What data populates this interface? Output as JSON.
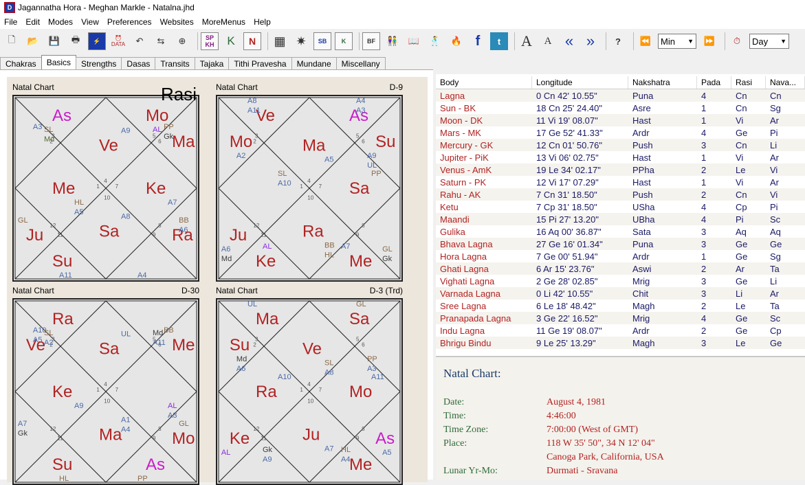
{
  "window": {
    "title": "Jagannatha Hora - Meghan Markle - Natalna.jhd",
    "icon": "jhora-app-icon"
  },
  "menu": [
    "File",
    "Edit",
    "Modes",
    "View",
    "Preferences",
    "Websites",
    "MoreMenus",
    "Help"
  ],
  "toolbar": {
    "icons": [
      "new-file-icon",
      "open-folder-icon",
      "save-icon",
      "print-icon",
      "data-icon",
      "clock-data-icon",
      "undo-arrow-icon",
      "redo-arrow-icon",
      "circle-chart-icon",
      "sp-kh-icon",
      "k-icon",
      "n-icon",
      "grid-chart-icon",
      "sun-rays-icon",
      "sb-icon",
      "k-square-icon",
      "bf-grid-icon",
      "couple-icon",
      "book-icon",
      "dancing-icon",
      "fire-icon",
      "facebook-icon",
      "twitter-icon",
      "font-large-icon",
      "font-small-icon",
      "back-icon",
      "forward-icon",
      "help-icon",
      "step-back-icon",
      "step-forward-icon",
      "transit-clock-icon"
    ],
    "labels": {
      "sp": "SP",
      "kh": "KH",
      "k": "K",
      "n": "N",
      "sb": "SB",
      "bf": "BF",
      "data": "DATA",
      "font_large": "A",
      "font_small": "A",
      "help": "?"
    },
    "time_unit": "Min",
    "date_unit": "Day"
  },
  "tabs": [
    "Chakras",
    "Basics",
    "Strengths",
    "Dasas",
    "Transits",
    "Tajaka",
    "Tithi Pravesha",
    "Mundane",
    "Miscellany"
  ],
  "active_tab": "Basics",
  "charts": [
    {
      "title": "Natal Chart",
      "division": "",
      "overlay": "Rasi",
      "house_numbers": [
        "4",
        "3",
        "2",
        "1",
        "12",
        "11",
        "10",
        "9",
        "8",
        "7",
        "6",
        "5"
      ],
      "planets": [
        {
          "t": "Ve",
          "c": "red"
        },
        {
          "t": "Su",
          "c": "red"
        },
        {
          "t": "Ma",
          "c": "red"
        },
        {
          "t": "Me",
          "c": "red"
        },
        {
          "t": "Ra",
          "c": "red"
        },
        {
          "t": "As",
          "c": "mag"
        },
        {
          "t": "Sa",
          "c": "red"
        },
        {
          "t": "Mo",
          "c": "red"
        },
        {
          "t": "Ju",
          "c": "red"
        },
        {
          "t": "Ke",
          "c": "red"
        }
      ],
      "labels": [
        {
          "t": "SL",
          "c": "brown"
        },
        {
          "t": "BB",
          "c": "brown"
        },
        {
          "t": "HL",
          "c": "brown"
        },
        {
          "t": "PP",
          "c": "brown"
        },
        {
          "t": "A11",
          "c": "blue"
        },
        {
          "t": "A9",
          "c": "blue"
        },
        {
          "t": "A4",
          "c": "blue"
        },
        {
          "t": "A3",
          "c": "blue"
        },
        {
          "t": "A7",
          "c": "blue"
        },
        {
          "t": "GL",
          "c": "brown"
        },
        {
          "t": "AL",
          "c": "purple"
        },
        {
          "t": "A8",
          "c": "blue"
        },
        {
          "t": "Md",
          "c": "green"
        },
        {
          "t": "A6",
          "c": "blue"
        },
        {
          "t": "A5",
          "c": "blue"
        },
        {
          "t": "Gk",
          "c": "dark"
        },
        {
          "t": "A9",
          "c": "blue"
        }
      ]
    },
    {
      "title": "Natal Chart",
      "division": "D-9",
      "overlay": "",
      "house_numbers": [
        "4",
        "3",
        "2",
        "1",
        "12",
        "11",
        "10",
        "9",
        "8",
        "7",
        "6",
        "5"
      ],
      "planets": [
        {
          "t": "Ve",
          "c": "red"
        },
        {
          "t": "Ra",
          "c": "red"
        },
        {
          "t": "As",
          "c": "mag"
        },
        {
          "t": "Ju",
          "c": "red"
        },
        {
          "t": "Sa",
          "c": "red"
        },
        {
          "t": "Mo",
          "c": "red"
        },
        {
          "t": "Me",
          "c": "red"
        },
        {
          "t": "Ma",
          "c": "red"
        },
        {
          "t": "Ke",
          "c": "red"
        },
        {
          "t": "Su",
          "c": "red"
        }
      ],
      "labels": [
        {
          "t": "A6",
          "c": "blue"
        },
        {
          "t": "A4",
          "c": "blue"
        },
        {
          "t": "BB",
          "c": "brown"
        },
        {
          "t": "A8",
          "c": "blue"
        },
        {
          "t": "GL",
          "c": "brown"
        },
        {
          "t": "SL",
          "c": "brown"
        },
        {
          "t": "A9",
          "c": "blue"
        },
        {
          "t": "AL",
          "c": "purple"
        },
        {
          "t": "A5",
          "c": "blue"
        },
        {
          "t": "A7",
          "c": "blue"
        },
        {
          "t": "A2",
          "c": "blue"
        },
        {
          "t": "PP",
          "c": "brown"
        },
        {
          "t": "Md",
          "c": "dark"
        },
        {
          "t": "A3",
          "c": "blue"
        },
        {
          "t": "HL",
          "c": "brown"
        },
        {
          "t": "A11",
          "c": "blue"
        },
        {
          "t": "Gk",
          "c": "dark"
        },
        {
          "t": "A10",
          "c": "blue"
        },
        {
          "t": "UL",
          "c": "blue"
        }
      ]
    },
    {
      "title": "Natal Chart",
      "division": "D-30",
      "overlay": "",
      "house_numbers": [
        "4",
        "3",
        "2",
        "1",
        "12",
        "11",
        "10",
        "9",
        "8",
        "7",
        "6",
        "5"
      ],
      "planets": [
        {
          "t": "Ve",
          "c": "red"
        },
        {
          "t": "As",
          "c": "mag"
        },
        {
          "t": "Sa",
          "c": "red"
        },
        {
          "t": "Su",
          "c": "red"
        },
        {
          "t": "Me",
          "c": "red"
        },
        {
          "t": "Ke",
          "c": "red"
        },
        {
          "t": "Mo",
          "c": "red"
        },
        {
          "t": "Ra",
          "c": "red"
        },
        {
          "t": "Ma",
          "c": "red"
        }
      ],
      "labels": [
        {
          "t": "PP",
          "c": "brown"
        },
        {
          "t": "A10",
          "c": "blue"
        },
        {
          "t": "AL",
          "c": "purple"
        },
        {
          "t": "A7",
          "c": "blue"
        },
        {
          "t": "Md",
          "c": "dark"
        },
        {
          "t": "A1",
          "c": "blue"
        },
        {
          "t": "SL",
          "c": "brown"
        },
        {
          "t": "GL",
          "c": "brown"
        },
        {
          "t": "A9",
          "c": "blue"
        },
        {
          "t": "BB",
          "c": "brown"
        },
        {
          "t": "HL",
          "c": "brown"
        },
        {
          "t": "UL",
          "c": "blue"
        },
        {
          "t": "A6",
          "c": "blue"
        },
        {
          "t": "A5",
          "c": "blue"
        },
        {
          "t": "A3",
          "c": "blue"
        },
        {
          "t": "Gk",
          "c": "dark"
        },
        {
          "t": "A11",
          "c": "blue"
        },
        {
          "t": "A4",
          "c": "blue"
        },
        {
          "t": "A2",
          "c": "blue"
        }
      ]
    },
    {
      "title": "Natal Chart",
      "division": "D-3 (Trd)",
      "overlay": "",
      "house_numbers": [
        "4",
        "3",
        "2",
        "1",
        "12",
        "11",
        "10",
        "9",
        "8",
        "7",
        "6",
        "5"
      ],
      "planets": [
        {
          "t": "Ra",
          "c": "red"
        },
        {
          "t": "As",
          "c": "mag"
        },
        {
          "t": "Ma",
          "c": "red"
        },
        {
          "t": "Ju",
          "c": "red"
        },
        {
          "t": "Sa",
          "c": "red"
        },
        {
          "t": "Ke",
          "c": "red"
        },
        {
          "t": "Mo",
          "c": "red"
        },
        {
          "t": "Su",
          "c": "red"
        },
        {
          "t": "Me",
          "c": "red"
        },
        {
          "t": "Ve",
          "c": "red"
        }
      ],
      "labels": [
        {
          "t": "PP",
          "c": "brown"
        },
        {
          "t": "Gk",
          "c": "dark"
        },
        {
          "t": "SL",
          "c": "brown"
        },
        {
          "t": "HL",
          "c": "brown"
        },
        {
          "t": "Md",
          "c": "dark"
        },
        {
          "t": "A11",
          "c": "blue"
        },
        {
          "t": "AL",
          "c": "purple"
        },
        {
          "t": "GL",
          "c": "brown"
        },
        {
          "t": "A7",
          "c": "blue"
        },
        {
          "t": "UL",
          "c": "blue"
        },
        {
          "t": "A5",
          "c": "blue"
        },
        {
          "t": "A10",
          "c": "blue"
        },
        {
          "t": "A3",
          "c": "blue"
        },
        {
          "t": "A9",
          "c": "blue"
        },
        {
          "t": "A8",
          "c": "blue"
        },
        {
          "t": "A4",
          "c": "blue"
        },
        {
          "t": "A6",
          "c": "blue"
        }
      ]
    }
  ],
  "table": {
    "headers": [
      "Body",
      "Longitude",
      "Nakshatra",
      "Pada",
      "Rasi",
      "Nava..."
    ],
    "rows": [
      [
        "Lagna",
        "0 Cn 42' 10.55\"",
        "Puna",
        "4",
        "Cn",
        "Cn"
      ],
      [
        "Sun - BK",
        "18 Cn 25' 24.40\"",
        "Asre",
        "1",
        "Cn",
        "Sg"
      ],
      [
        "Moon - DK",
        "11 Vi 19' 08.07\"",
        "Hast",
        "1",
        "Vi",
        "Ar"
      ],
      [
        "Mars - MK",
        "17 Ge 52' 41.33\"",
        "Ardr",
        "4",
        "Ge",
        "Pi"
      ],
      [
        "Mercury - GK",
        "12 Cn 01' 50.76\"",
        "Push",
        "3",
        "Cn",
        "Li"
      ],
      [
        "Jupiter - PiK",
        "13 Vi 06' 02.75\"",
        "Hast",
        "1",
        "Vi",
        "Ar"
      ],
      [
        "Venus - AmK",
        "19 Le 34' 02.17\"",
        "PPha",
        "2",
        "Le",
        "Vi"
      ],
      [
        "Saturn - PK",
        "12 Vi 17' 07.29\"",
        "Hast",
        "1",
        "Vi",
        "Ar"
      ],
      [
        "Rahu - AK",
        "7 Cn 31' 18.50\"",
        "Push",
        "2",
        "Cn",
        "Vi"
      ],
      [
        "Ketu",
        "7 Cp 31' 18.50\"",
        "USha",
        "4",
        "Cp",
        "Pi"
      ],
      [
        "Maandi",
        "15 Pi 27' 13.20\"",
        "UBha",
        "4",
        "Pi",
        "Sc"
      ],
      [
        "Gulika",
        "16 Aq 00' 36.87\"",
        "Sata",
        "3",
        "Aq",
        "Aq"
      ],
      [
        "Bhava Lagna",
        "27 Ge 16' 01.34\"",
        "Puna",
        "3",
        "Ge",
        "Ge"
      ],
      [
        "Hora Lagna",
        "7 Ge 00' 51.94\"",
        "Ardr",
        "1",
        "Ge",
        "Sg"
      ],
      [
        "Ghati Lagna",
        "6 Ar 15' 23.76\"",
        "Aswi",
        "2",
        "Ar",
        "Ta"
      ],
      [
        "Vighati Lagna",
        "2 Ge 28' 02.85\"",
        "Mrig",
        "3",
        "Ge",
        "Li"
      ],
      [
        "Varnada Lagna",
        "0 Li 42' 10.55\"",
        "Chit",
        "3",
        "Li",
        "Ar"
      ],
      [
        "Sree Lagna",
        "6 Le 18' 48.42\"",
        "Magh",
        "2",
        "Le",
        "Ta"
      ],
      [
        "Pranapada Lagna",
        "3 Ge 22' 16.52\"",
        "Mrig",
        "4",
        "Ge",
        "Sc"
      ],
      [
        "Indu Lagna",
        "11 Ge 19' 08.07\"",
        "Ardr",
        "2",
        "Ge",
        "Cp"
      ],
      [
        "Bhrigu Bindu",
        "9 Le 25' 13.29\"",
        "Magh",
        "3",
        "Le",
        "Ge"
      ]
    ]
  },
  "info": {
    "title": "Natal Chart:",
    "rows": [
      {
        "k": "Date:",
        "v": "August 4, 1981"
      },
      {
        "k": "Time:",
        "v": "4:46:00"
      },
      {
        "k": "Time Zone:",
        "v": "7:00:00 (West of GMT)"
      },
      {
        "k": "Place:",
        "v": "118 W 35' 50\", 34 N 12' 04\""
      },
      {
        "k": "",
        "v": "Canoga Park, California, USA"
      },
      {
        "k": "Lunar Yr-Mo:",
        "v": "Durmati - Sravana"
      }
    ]
  },
  "colors": {
    "planet_red": "#b22222",
    "ascendant_magenta": "#c81ec8",
    "chart_bg": "#ece6dc",
    "info_key": "#2e6b3a"
  }
}
